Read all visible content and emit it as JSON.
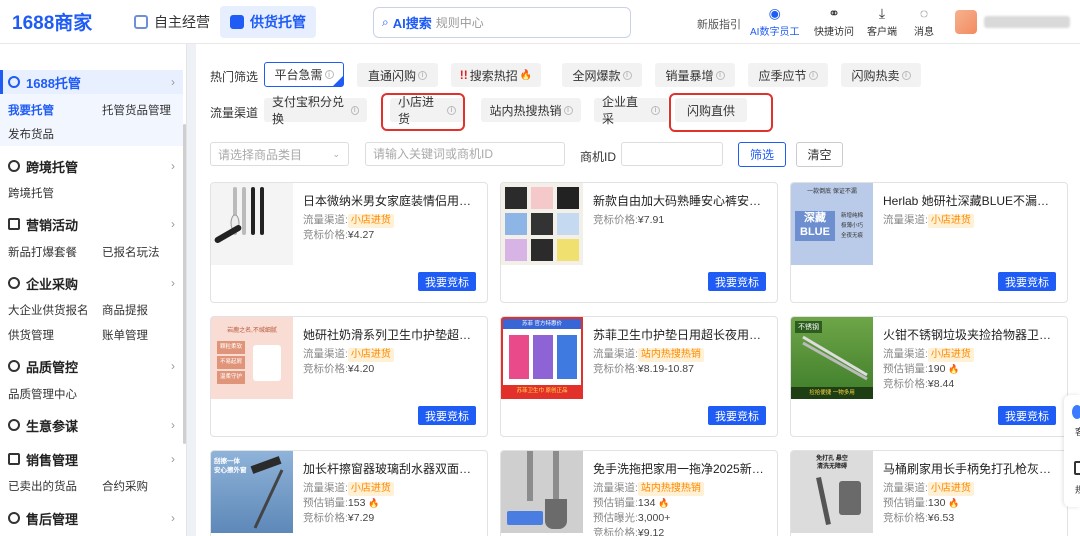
{
  "header": {
    "logo_main": "1688",
    "logo_tail": "商家",
    "tabs": [
      {
        "label": "自主经营",
        "active": false
      },
      {
        "label": "供货托管",
        "active": true
      }
    ],
    "ai_label": "AI搜索",
    "search_placeholder": "规则中心",
    "guide": "新版指引",
    "tools": [
      {
        "label": "AI数字员工",
        "icon": "ai-robot-icon"
      },
      {
        "label": "快捷访问",
        "icon": "link-icon"
      },
      {
        "label": "客户端",
        "icon": "download-icon"
      },
      {
        "label": "消息",
        "icon": "chat-icon"
      }
    ]
  },
  "sidebar": {
    "sections": [
      {
        "label": "1688托管",
        "active": true,
        "items": [
          [
            "我要托管",
            "托管货品管理"
          ],
          [
            "发布货品"
          ]
        ]
      },
      {
        "label": "跨境托管",
        "active": false,
        "items": [
          [
            "跨境托管"
          ]
        ]
      },
      {
        "label": "营销活动",
        "active": false,
        "items": [
          [
            "新品打爆套餐",
            "已报名玩法"
          ]
        ]
      },
      {
        "label": "企业采购",
        "active": false,
        "items": [
          [
            "大企业供货报名",
            "商品提报"
          ],
          [
            "供货管理",
            "账单管理"
          ]
        ]
      },
      {
        "label": "品质管控",
        "active": false,
        "items": [
          [
            "品质管理中心"
          ]
        ]
      },
      {
        "label": "生意参谋",
        "active": false,
        "items": []
      },
      {
        "label": "销售管理",
        "active": false,
        "items": [
          [
            "已卖出的货品",
            "合约采购"
          ]
        ]
      },
      {
        "label": "售后管理",
        "active": false,
        "items": []
      }
    ]
  },
  "filters": {
    "hot_label": "热门筛选",
    "hot": [
      "平台急需",
      "直通闪购",
      "搜索热招",
      "全网爆款",
      "销量暴增",
      "应季应节",
      "闪购热卖"
    ],
    "hot_bang": "!!",
    "channel_label": "流量渠道",
    "channels": [
      "支付宝积分兑换",
      "小店进货",
      "站内热搜热销",
      "企业直采",
      "闪购直供"
    ],
    "category_placeholder": "请选择商品类目",
    "keyword_placeholder": "请输入关键词或商机ID",
    "opp_label": "商机ID",
    "filter_btn": "筛选",
    "clear_btn": "清空"
  },
  "labels": {
    "channel": "流量渠道:",
    "price": "竞标价格:",
    "sales": "预估销量:",
    "exposure": "预估曝光:",
    "bid": "我要竞标"
  },
  "cards": [
    {
      "title": "日本微纳米男女家庭装情侣用牙刷...",
      "channel": "小店进货",
      "price": "¥4.27"
    },
    {
      "title": "新款自由加大码熟睡安心裤安睡裤...",
      "price": "¥7.91"
    },
    {
      "title": "Herlab 她研社深藏BLUE不漏超薄...",
      "channel": "小店进货"
    },
    {
      "title": "她研社奶滑系列卫生巾护垫超薄棉...",
      "channel": "小店进货",
      "price": "¥4.20"
    },
    {
      "title": "苏菲卫生巾护垫日用超长夜用安心...",
      "channel": "站内热搜热销",
      "price": "¥8.19-10.87"
    },
    {
      "title": "火钳不锈钢垃圾夹捡拾物器卫生钳...",
      "channel": "小店进货",
      "sales": "190",
      "price": "¥8.44"
    },
    {
      "title": "加长杆擦窗器玻璃刮水器双面擦高...",
      "channel": "小店进货",
      "sales": "153",
      "price": "¥7.29"
    },
    {
      "title": "免手洗拖把家用一拖净2025新款...",
      "channel": "站内热搜热销",
      "sales": "134",
      "exposure": "3,000+",
      "price": "¥9.12"
    },
    {
      "title": "马桶刷家用长手柄免打孔枪灰色厕...",
      "channel": "小店进货",
      "sales": "130",
      "price": "¥6.53"
    }
  ],
  "thumb_text": {
    "c3_top": "一款倒底 保证不漏",
    "c3_main": "深藏",
    "c3_main2": "BLUE",
    "c3_side": [
      "新增纯棉",
      "极薄小巧",
      "全夜无痕"
    ],
    "c4_top": "岩鹿之名,不缄细腻",
    "c4_tags": [
      "颗粒柔软",
      "不易起屑",
      "温柔守护"
    ],
    "c5_top": "苏菲 官方特惠价",
    "c5_bottom": "苏菲卫生巾 原创正品",
    "c6_top": "不锈钢",
    "c6_bottom": "捡拾便捷 一物多用",
    "c7_top": "刮擦一体",
    "c7_top2": "安心擦外窗",
    "c9_top": "免打孔 悬空",
    "c9_top2": "清洗无障碍"
  },
  "edge_widget": {
    "w2": "客",
    "w4": "规"
  },
  "colors": {
    "accent": "#1f5cf5",
    "tag_bg": "#fff1d6",
    "tag_fg": "#ff8a00",
    "highlight": "#e0312b"
  }
}
